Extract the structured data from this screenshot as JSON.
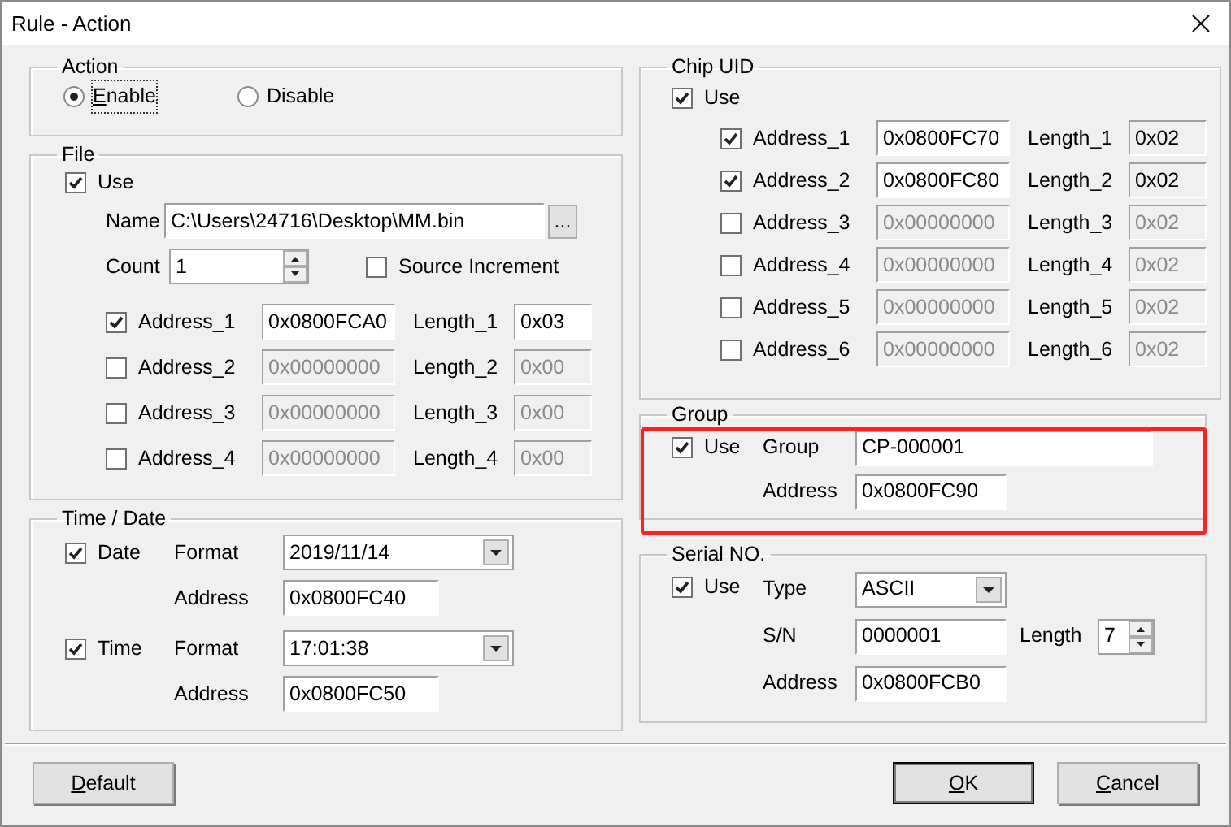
{
  "window": {
    "title": "Rule - Action"
  },
  "action": {
    "legend": "Action",
    "options": [
      {
        "label": "Enable",
        "selected": true,
        "focused": true
      },
      {
        "label": "Disable",
        "selected": false,
        "focused": false
      }
    ]
  },
  "file": {
    "legend": "File",
    "use": {
      "label": "Use",
      "checked": true
    },
    "name_label": "Name",
    "name": "C:\\Users\\24716\\Desktop\\MM.bin",
    "browse": "...",
    "count_label": "Count",
    "count": "1",
    "source_increment": {
      "label": "Source Increment",
      "checked": false
    },
    "addresses": [
      {
        "label": "Address_1",
        "checked": true,
        "address": "0x0800FCA0",
        "length_label": "Length_1",
        "length": "0x03"
      },
      {
        "label": "Address_2",
        "checked": false,
        "address": "0x00000000",
        "length_label": "Length_2",
        "length": "0x00"
      },
      {
        "label": "Address_3",
        "checked": false,
        "address": "0x00000000",
        "length_label": "Length_3",
        "length": "0x00"
      },
      {
        "label": "Address_4",
        "checked": false,
        "address": "0x00000000",
        "length_label": "Length_4",
        "length": "0x00"
      }
    ]
  },
  "time_date": {
    "legend": "Time / Date",
    "items": [
      {
        "label": "Date",
        "checked": true,
        "format_label": "Format",
        "format": "2019/11/14",
        "address_label": "Address",
        "address": "0x0800FC40"
      },
      {
        "label": "Time",
        "checked": true,
        "format_label": "Format",
        "format": "17:01:38",
        "address_label": "Address",
        "address": "0x0800FC50"
      }
    ]
  },
  "chip_uid": {
    "legend": "Chip UID",
    "use": {
      "label": "Use",
      "checked": true
    },
    "lengths_read_only": true,
    "addresses": [
      {
        "label": "Address_1",
        "checked": true,
        "address": "0x0800FC70",
        "length_label": "Length_1",
        "length": "0x02"
      },
      {
        "label": "Address_2",
        "checked": true,
        "address": "0x0800FC80",
        "length_label": "Length_2",
        "length": "0x02"
      },
      {
        "label": "Address_3",
        "checked": false,
        "address": "0x00000000",
        "length_label": "Length_3",
        "length": "0x02"
      },
      {
        "label": "Address_4",
        "checked": false,
        "address": "0x00000000",
        "length_label": "Length_4",
        "length": "0x02"
      },
      {
        "label": "Address_5",
        "checked": false,
        "address": "0x00000000",
        "length_label": "Length_5",
        "length": "0x02"
      },
      {
        "label": "Address_6",
        "checked": false,
        "address": "0x00000000",
        "length_label": "Length_6",
        "length": "0x02"
      }
    ]
  },
  "group": {
    "legend": "Group",
    "highlighted": true,
    "use": {
      "label": "Use",
      "checked": true
    },
    "group_label": "Group",
    "group": "CP-000001",
    "address_label": "Address",
    "address": "0x0800FC90"
  },
  "serial": {
    "legend": "Serial NO.",
    "use": {
      "label": "Use",
      "checked": true
    },
    "type_label": "Type",
    "type": "ASCII",
    "sn_label": "S/N",
    "sn": "0000001",
    "length_label": "Length",
    "length": "7",
    "address_label": "Address",
    "address": "0x0800FCB0"
  },
  "buttons": [
    {
      "label": "Default",
      "default": false
    },
    {
      "label": "OK",
      "default": true
    },
    {
      "label": "Cancel",
      "default": false
    }
  ]
}
